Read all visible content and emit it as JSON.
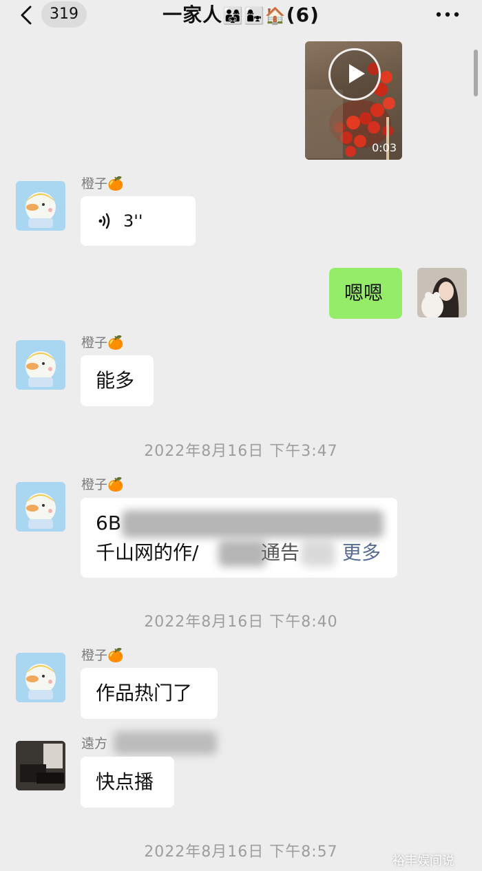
{
  "header": {
    "unread_count": "319",
    "title": "一家人",
    "title_emoji": "👨‍👩‍👧👩‍👧🏠",
    "member_count": "(6)"
  },
  "messages": {
    "video": {
      "duration": "0:03"
    },
    "m1": {
      "sender": "橙子🍊",
      "voice_duration": "3''"
    },
    "m2": {
      "text": "嗯嗯"
    },
    "m3": {
      "sender": "橙子🍊",
      "text": "能多"
    },
    "ts1": "2022年8月16日 下午3:47",
    "m4": {
      "sender": "橙子🍊",
      "line1": "6B",
      "line2": "千山网的作/",
      "line2_tail": "通告",
      "more": "更多"
    },
    "ts2": "2022年8月16日 下午8:40",
    "m5": {
      "sender": "橙子🍊",
      "text": "作品热门了"
    },
    "m6": {
      "sender": "遠方",
      "text": "快点播"
    },
    "ts3": "2022年8月16日 下午8:57"
  },
  "watermark": "裕丰娱间说"
}
